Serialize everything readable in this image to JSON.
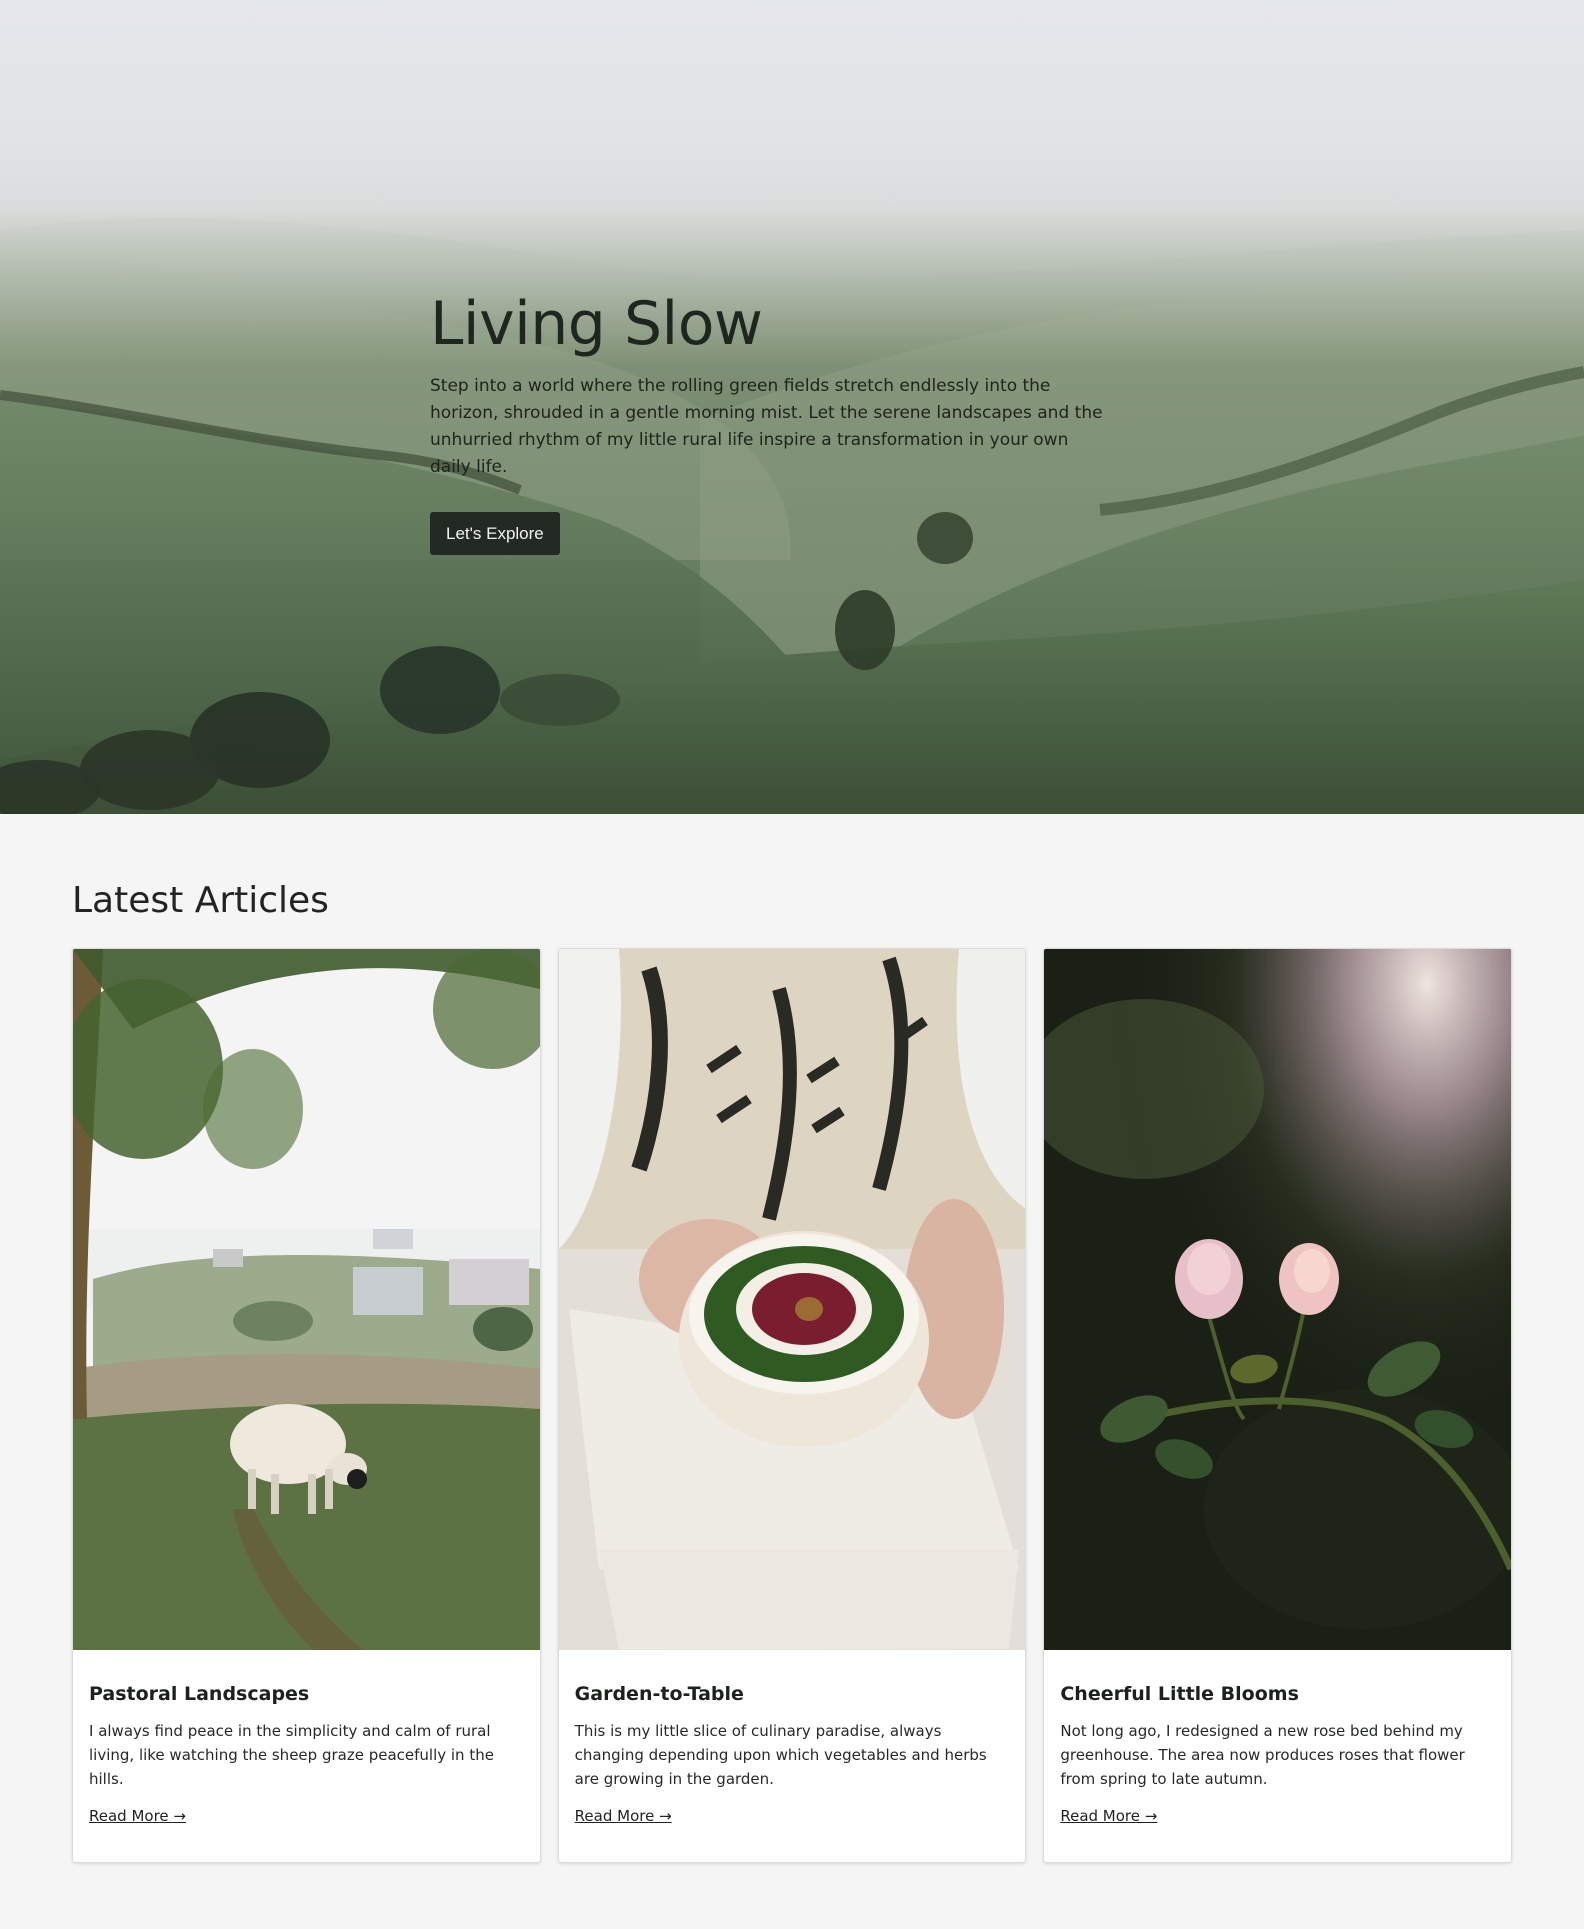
{
  "hero": {
    "title": "Living Slow",
    "description": "Step into a world where the rolling green fields stretch endlessly into the horizon, shrouded in a gentle morning mist. Let the serene landscapes and the unhurried rhythm of my little rural life inspire a transformation in your own daily life.",
    "button_label": "Let's Explore",
    "image": "misty-rolling-hills-photo"
  },
  "articles": {
    "heading": "Latest Articles",
    "items": [
      {
        "image": "sheep-grazing-hillside-photo",
        "title": "Pastoral Landscapes",
        "text": "I always find peace in the simplicity and calm of rural living, like watching the sheep graze peacefully in the hills.",
        "link": "Read More →"
      },
      {
        "image": "salad-bowl-held-in-hands-photo",
        "title": "Garden-to-Table",
        "text": "This is my little slice of culinary paradise, always changing depending upon which vegetables and herbs are growing in the garden.",
        "link": "Read More →"
      },
      {
        "image": "pink-roses-in-sunlight-photo",
        "title": "Cheerful Little Blooms",
        "text": "Not long ago, I redesigned a new rose bed behind my greenhouse. The area now produces roses that flower from spring to late autumn.",
        "link": "Read More →"
      }
    ]
  },
  "colors": {
    "page_bg": "#f5f5f5",
    "button_bg": "#232a24",
    "hero_green": "#617a5a"
  }
}
